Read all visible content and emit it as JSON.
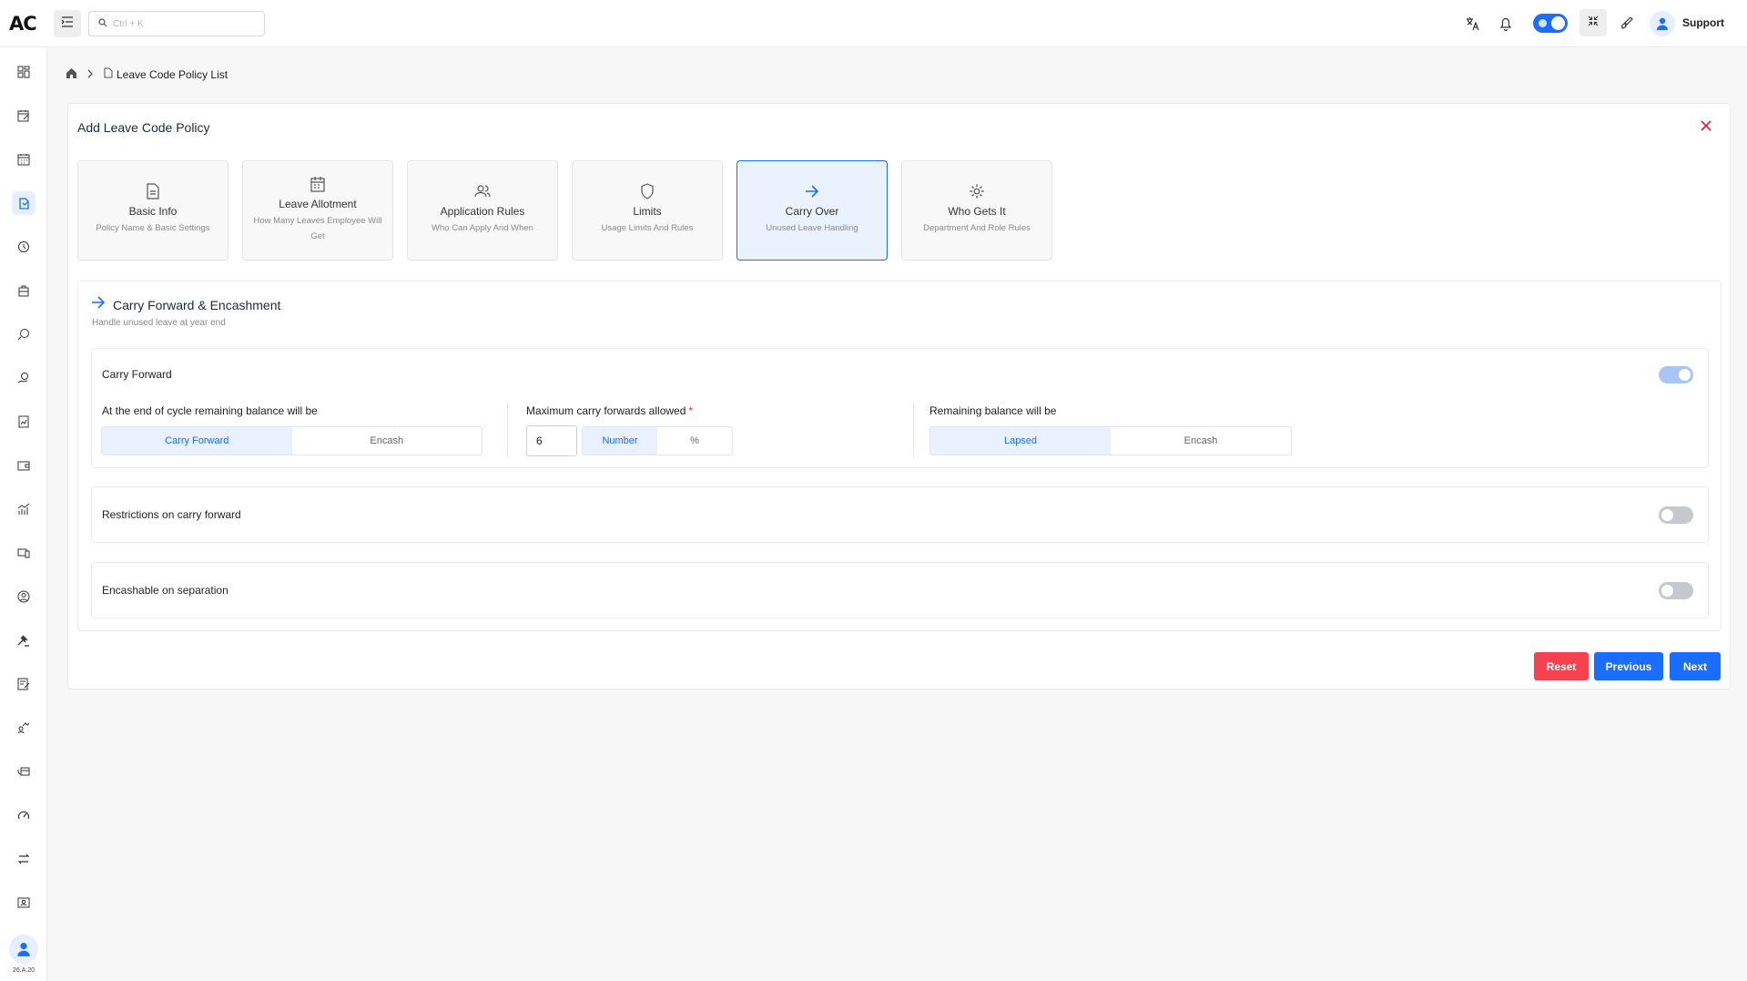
{
  "app": {
    "logo": "AC",
    "support_label": "Support",
    "version": "26.A.20"
  },
  "search": {
    "placeholder": "Ctrl + K"
  },
  "breadcrumb": {
    "page": "Leave Code Policy List"
  },
  "card": {
    "title": "Add Leave Code Policy"
  },
  "steps": [
    {
      "label": "Basic Info",
      "sub": "Policy Name & Basic Settings",
      "icon": "document-icon"
    },
    {
      "label": "Leave Allotment",
      "sub": "How Many Leaves Employee Will Get",
      "icon": "calendar-icon"
    },
    {
      "label": "Application Rules",
      "sub": "Who Can Apply And When",
      "icon": "users-icon"
    },
    {
      "label": "Limits",
      "sub": "Usage Limits And Rules",
      "icon": "shield-icon"
    },
    {
      "label": "Carry Over",
      "sub": "Unused Leave Handling",
      "icon": "arrow-right-icon"
    },
    {
      "label": "Who Gets It",
      "sub": "Department And Role Rules",
      "icon": "gear-icon"
    }
  ],
  "active_step": 4,
  "section": {
    "title": "Carry Forward & Encashment",
    "subtitle": "Handle unused leave at year end"
  },
  "carry_forward": {
    "label": "Carry Forward",
    "enabled": true,
    "cycle_label": "At the end of cycle remaining balance will be",
    "cycle_options": [
      "Carry Forward",
      "Encash"
    ],
    "cycle_selected": "Carry Forward",
    "max_label": "Maximum carry forwards allowed",
    "max_required_mark": "*",
    "max_value": "6",
    "max_unit_options": [
      "Number",
      "%"
    ],
    "max_unit_selected": "Number",
    "remaining_label": "Remaining balance will be",
    "remaining_options": [
      "Lapsed",
      "Encash"
    ],
    "remaining_selected": "Lapsed"
  },
  "restrictions": {
    "label": "Restrictions on carry forward",
    "enabled": false
  },
  "encashable": {
    "label": "Encashable on separation",
    "enabled": false
  },
  "buttons": {
    "reset": "Reset",
    "previous": "Previous",
    "next": "Next"
  },
  "colors": {
    "accent": "#1a6dff",
    "danger": "#f5424e",
    "active_bg": "#eaf3fd"
  }
}
